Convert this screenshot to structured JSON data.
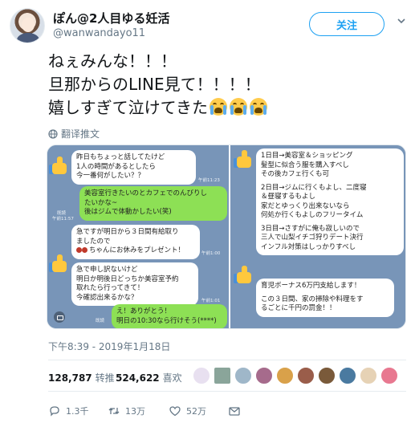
{
  "profile": {
    "display_name": "ぽん@2人目ゆる妊活",
    "username": "@wanwandayo11",
    "follow_label": "关注"
  },
  "tweet": {
    "lines": [
      "ねぇみんな！！！",
      "旦那からのLINE見て！！！！",
      "嬉しすぎて泣けてきた"
    ],
    "translate_label": "翻译推文",
    "date": "下午8:39 - 2019年1月18日"
  },
  "screenshot_left": {
    "bubble1": [
      "昨日もちょっと話してたけど",
      "1人の時間があるとしたら",
      "今一番何がしたい？？"
    ],
    "time1": "午前11:23",
    "bubble2": [
      "美容室行きたいのとカフェでのんびりし",
      "たいかな~",
      "後はジムで体動かしたい(笑)"
    ],
    "read2": "既読",
    "time2": "午前11:57",
    "bubble3_l1": "急ですが明日から３日間有給取り",
    "bubble3_l2": "ましたので",
    "bubble3_l3": "ちゃんにお休みをプレゼント！",
    "time3": "午前1:00",
    "bubble4": [
      "急で申し訳ないけど",
      "明日か明後日どっちか美容室予約",
      "取れたら行ってきて！",
      "今確認出来るかな？"
    ],
    "time4": "午前1:01",
    "bubble5": [
      "え！ありがとう！",
      "明日の10:30なら行けそう(****)"
    ],
    "read5": "既読"
  },
  "screenshot_right": {
    "bubble1": [
      "1日目→美容室＆ショッピング",
      "髪型に似合う服を購入すべし",
      "その後カフェ行くも可",
      "",
      "2日目→ジムに行くもよし、二度寝",
      "＆昼寝するもよし",
      "家だとゆっくり出来ないなら",
      "何処か行くもよしのフリータイム",
      "",
      "3日目→さすがに俺も寂しいので",
      "三人で山梨イチゴ狩りデート決行",
      "インフル対策はしっかりすべし"
    ],
    "bubble2": [
      "育児ボーナス6万円支給します！",
      "",
      "この３日間、家の掃除や料理をす",
      "るごとに千円の罰金！！"
    ]
  },
  "stats": {
    "retweets_count": "128,787",
    "retweets_label": "转推",
    "likes_count": "524,622",
    "likes_label": "喜欢"
  },
  "actions": {
    "reply_count": "1.3千",
    "retweet_count": "13万",
    "like_count": "52万"
  },
  "colors": {
    "accent": "#1da1f2",
    "line_green": "#8de055",
    "chat_bg": "#7895b8"
  }
}
